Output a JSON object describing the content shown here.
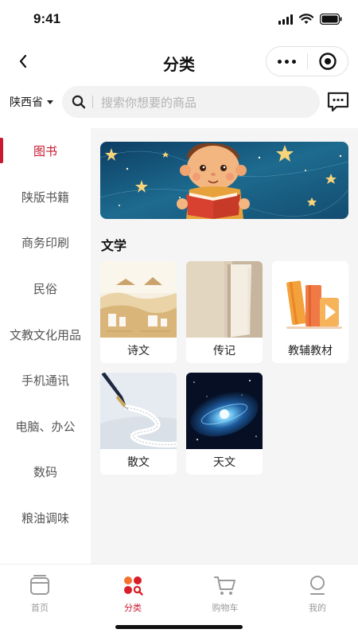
{
  "status_bar": {
    "time": "9:41"
  },
  "nav": {
    "title": "分类"
  },
  "search": {
    "province": "陕西省",
    "placeholder": "搜索你想要的商品"
  },
  "left_nav": {
    "active_index": 0,
    "items": [
      {
        "label": "图书"
      },
      {
        "label": "陕版书籍"
      },
      {
        "label": "商务印刷"
      },
      {
        "label": "民俗"
      },
      {
        "label": "文教文化用品"
      },
      {
        "label": "手机通讯"
      },
      {
        "label": "电脑、办公"
      },
      {
        "label": "数码"
      },
      {
        "label": "粮油调味"
      }
    ]
  },
  "content": {
    "section_title": "文学",
    "cards": [
      {
        "label": "诗文",
        "icon": "poetry-image"
      },
      {
        "label": "传记",
        "icon": "open-book-image"
      },
      {
        "label": "教辅教材",
        "icon": "books-play-image"
      },
      {
        "label": "散文",
        "icon": "fountain-pen-image"
      },
      {
        "label": "天文",
        "icon": "galaxy-image"
      }
    ]
  },
  "tab_bar": {
    "active_index": 1,
    "items": [
      {
        "label": "首页",
        "icon": "home-icon"
      },
      {
        "label": "分类",
        "icon": "category-icon"
      },
      {
        "label": "购物车",
        "icon": "cart-icon"
      },
      {
        "label": "我的",
        "icon": "profile-icon"
      }
    ]
  },
  "colors": {
    "accent": "#c8192e",
    "panel_bg": "#f5f5f5",
    "tab_inactive": "#9a9a9a"
  }
}
